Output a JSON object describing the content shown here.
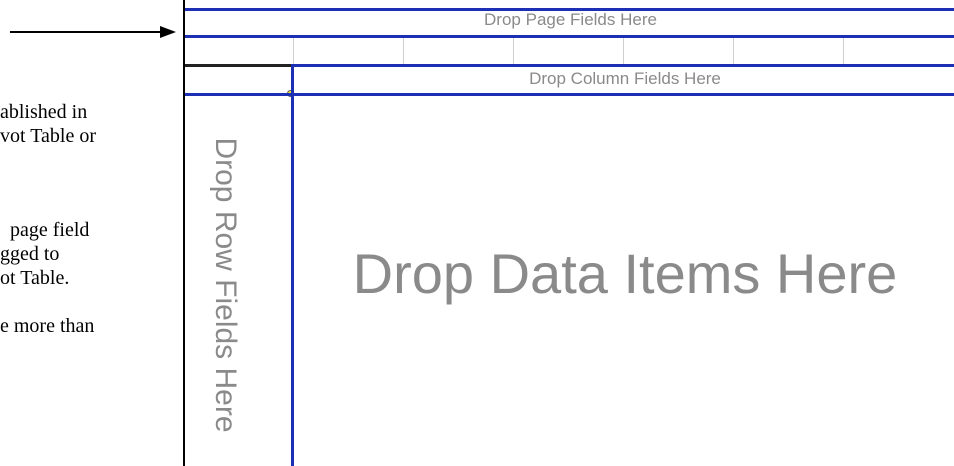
{
  "doc_lines": [
    "ablished in",
    "vot Table or",
    "page field",
    "gged to",
    "ot Table.",
    "e more than"
  ],
  "pivot": {
    "page_fields_label": "Drop Page Fields Here",
    "column_fields_label": "Drop Column Fields Here",
    "row_fields_label": "Drop Row Fields Here",
    "data_items_label": "Drop Data Items Here"
  },
  "colors": {
    "border_blue": "#1d2fb3",
    "label_gray": "#8a8a8a",
    "selection_yellow": "#f2e22a"
  }
}
